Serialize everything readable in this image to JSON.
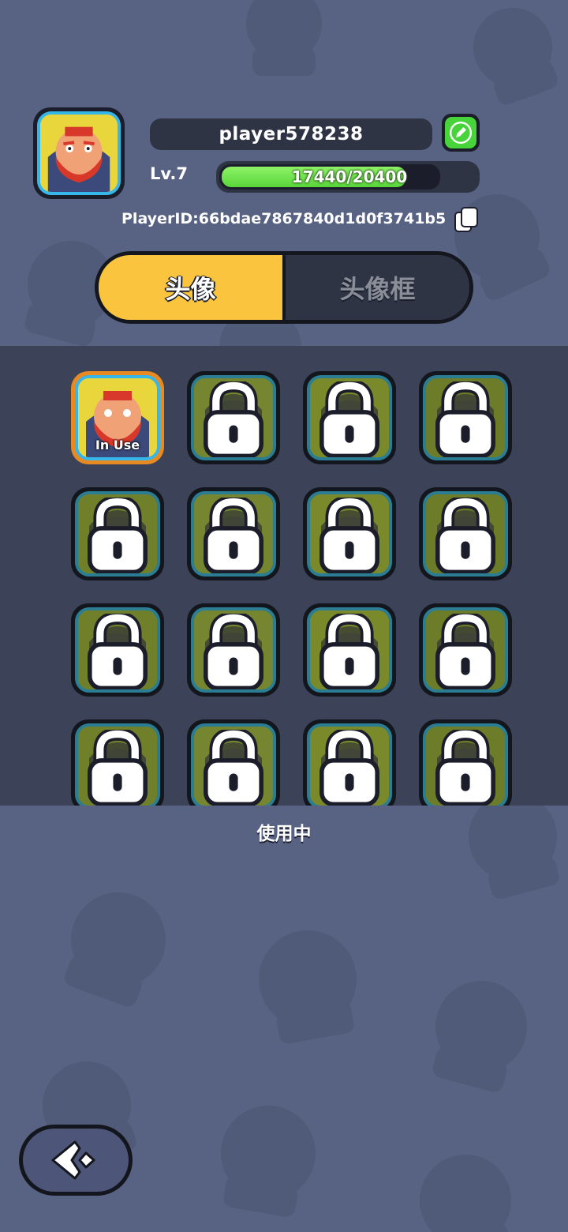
{
  "profile": {
    "username": "player578238",
    "level_label": "Lv.7",
    "xp_text": "17440/20400",
    "xp_progress": 0.855,
    "player_id": "PlayerID:66bdae7867840d1d0f3741b5"
  },
  "tabs": [
    {
      "label": "头像",
      "active": true
    },
    {
      "label": "头像框",
      "active": false
    }
  ],
  "avatars": [
    {
      "name": "avatar-king-red-beard",
      "status": "In Use",
      "locked": false
    },
    {
      "name": "avatar-queen",
      "locked": true
    },
    {
      "name": "avatar-pirate",
      "locked": true
    },
    {
      "name": "avatar-frog-king",
      "locked": true
    },
    {
      "name": "avatar-pink-hair",
      "locked": true
    },
    {
      "name": "avatar-dark-hair-girl",
      "locked": true
    },
    {
      "name": "avatar-robot",
      "locked": true
    },
    {
      "name": "avatar-blue-ogre",
      "locked": true
    },
    {
      "name": "avatar-old-king",
      "locked": true
    },
    {
      "name": "avatar-red-hood",
      "locked": true
    },
    {
      "name": "avatar-bandaged",
      "locked": true
    },
    {
      "name": "avatar-red-beret",
      "locked": true
    },
    {
      "name": "avatar-bow-girl",
      "locked": true
    },
    {
      "name": "avatar-bear-ears",
      "locked": true
    },
    {
      "name": "avatar-vampire",
      "locked": true
    },
    {
      "name": "avatar-black-hair-boy",
      "locked": true
    }
  ],
  "status_text": "使用中",
  "colors": {
    "background": "#586283",
    "tab_active": "#fbc43e",
    "xp_green": "#59d53a",
    "edit_green": "#46d43a",
    "frame_blue": "#37b6ea",
    "selected_orange": "#e88a22"
  },
  "icons": {
    "edit": "pencil-icon",
    "copy": "copy-icon",
    "lock": "lock-icon",
    "back": "back-arrow-icon"
  }
}
